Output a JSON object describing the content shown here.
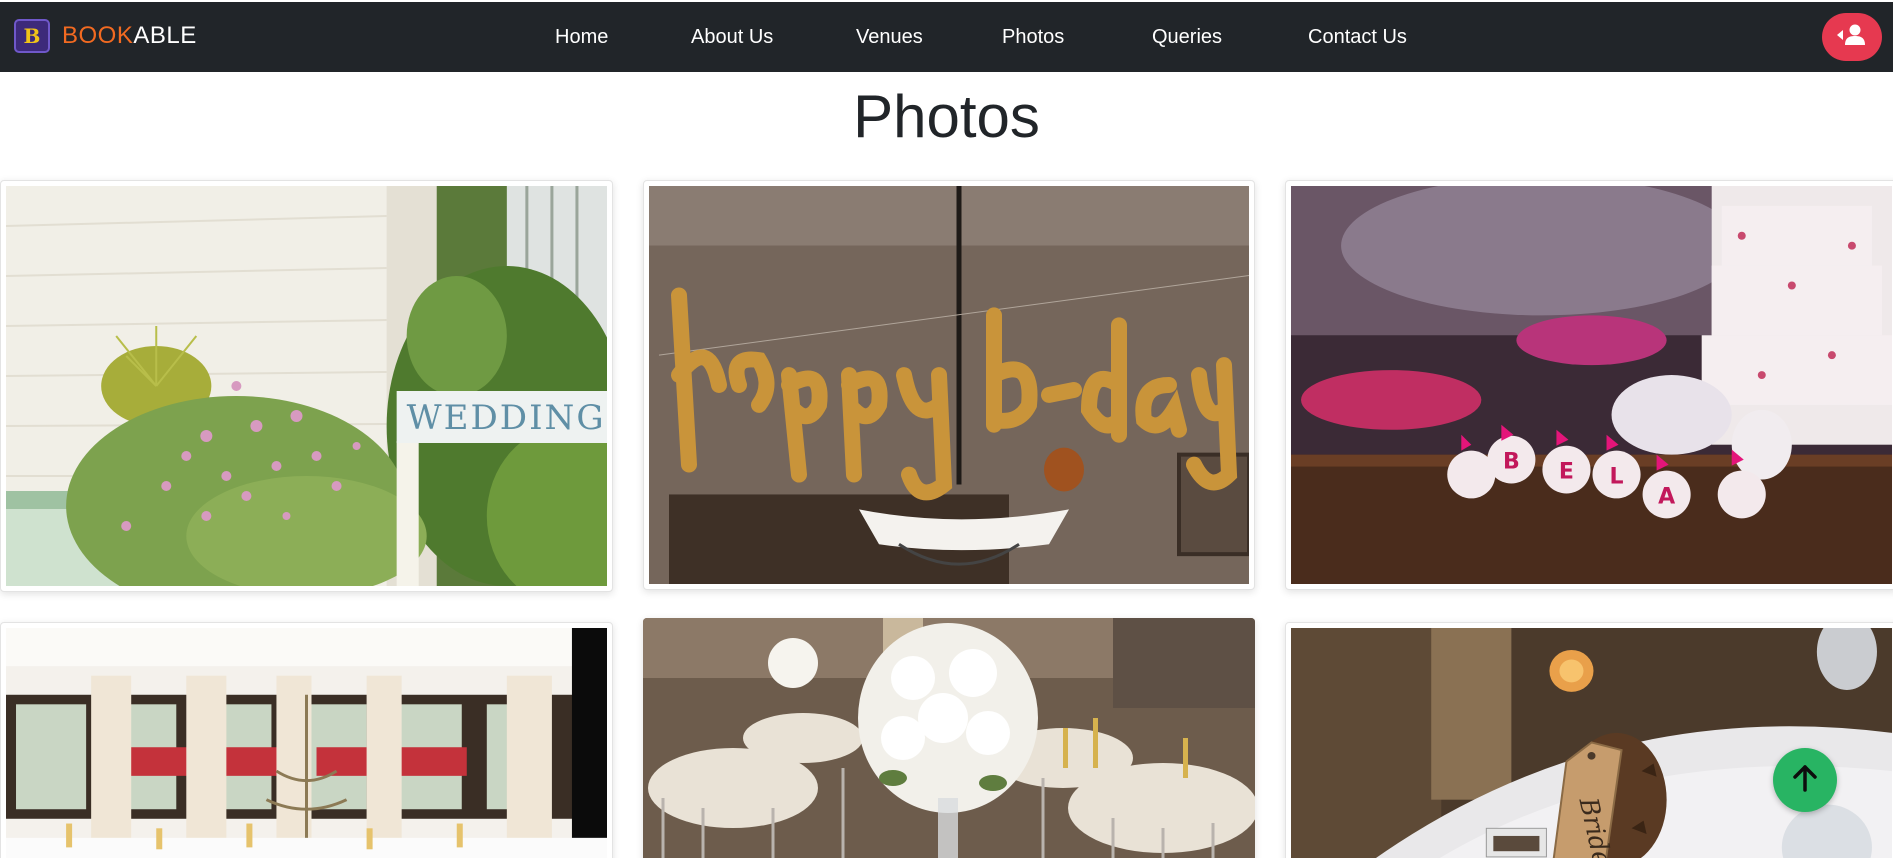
{
  "brand": {
    "logo_letter": "B",
    "name_part1": "BOOK",
    "name_part2": "ABLE"
  },
  "nav": {
    "items": [
      {
        "label": "Home"
      },
      {
        "label": "About Us"
      },
      {
        "label": "Venues"
      },
      {
        "label": "Photos"
      },
      {
        "label": "Queries"
      },
      {
        "label": "Contact Us"
      }
    ]
  },
  "user_button": {
    "icon": "user-icon"
  },
  "page": {
    "title": "Photos"
  },
  "photos": [
    {
      "subject": "wedding-sign-garden",
      "sign_text": "WEDDING"
    },
    {
      "subject": "happy-bday-balloons",
      "balloon_text": "happy b-day"
    },
    {
      "subject": "dessert-table",
      "letters": [
        "B",
        "E",
        "L",
        "A"
      ]
    },
    {
      "subject": "banquet-hall-candelabra"
    },
    {
      "subject": "white-hydrangea-centerpiece"
    },
    {
      "subject": "bride-place-card",
      "tag_text": "Bride"
    }
  ],
  "scroll_top": {
    "icon": "arrow-up-icon"
  },
  "colors": {
    "navbar": "#212529",
    "brand_accent": "#f26a21",
    "user_button": "#e63950",
    "scroll_top": "#28b463"
  }
}
